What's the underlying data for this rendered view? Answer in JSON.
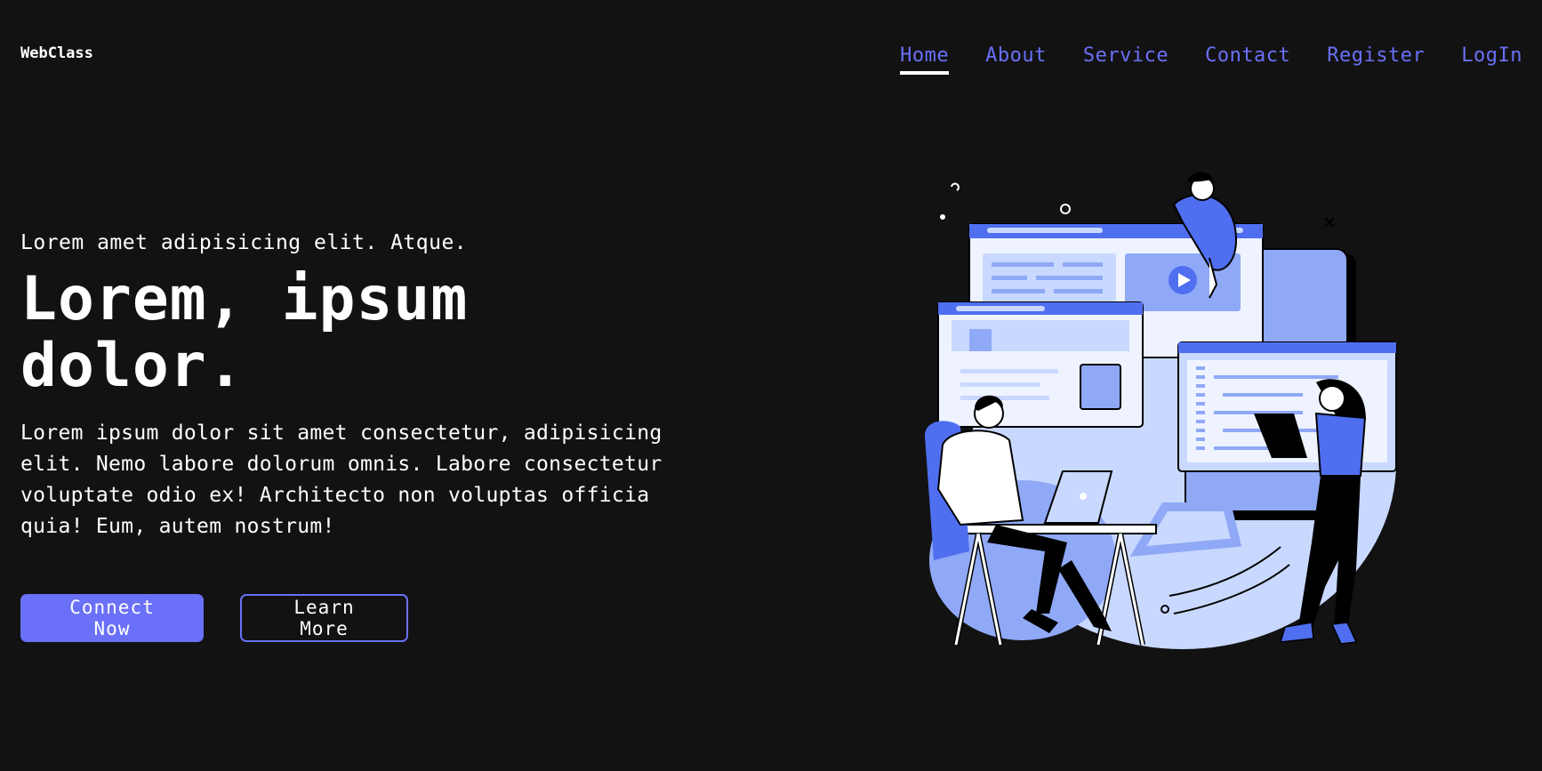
{
  "header": {
    "logo": "WebClass",
    "nav": [
      {
        "label": "Home",
        "active": true
      },
      {
        "label": "About"
      },
      {
        "label": "Service"
      },
      {
        "label": "Contact"
      },
      {
        "label": "Register"
      },
      {
        "label": "LogIn"
      }
    ]
  },
  "hero": {
    "eyebrow": "Lorem amet adipisicing elit. Atque.",
    "headline": "Lorem, ipsum dolor.",
    "description": "Lorem ipsum dolor sit amet consectetur, adipisicing elit. Nemo labore dolorum omnis. Labore consectetur voluptate odio ex! Architecto non voluptas officia quia! Eum, autem nostrum!",
    "primary_button": "Connect Now",
    "secondary_button": "Learn More"
  },
  "colors": {
    "background": "#121212",
    "accent": "#6a70f7",
    "illustration_light": "#c9d8ff",
    "illustration_mid": "#8fa9f7",
    "illustration_blue": "#4f6ff0"
  },
  "illustration": {
    "icon": "web-development-illustration"
  }
}
